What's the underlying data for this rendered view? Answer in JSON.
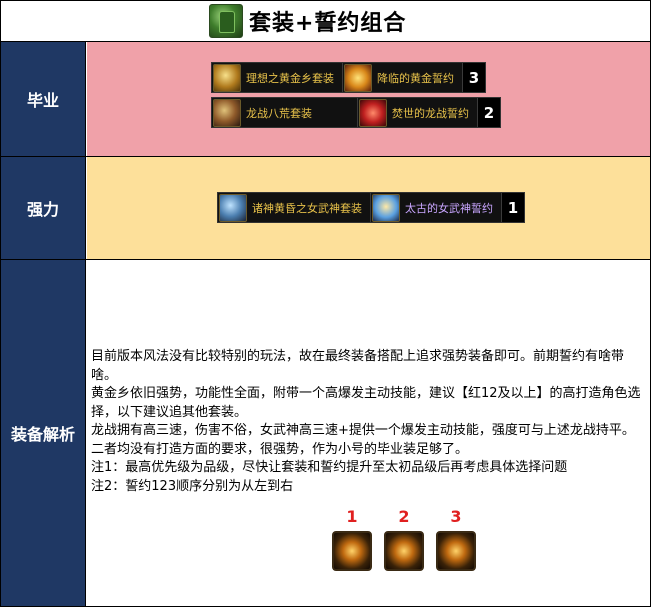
{
  "header": {
    "title": "套装+誓约组合",
    "icon": "green-armor-icon"
  },
  "rows": {
    "biye": {
      "label": "毕业",
      "combos": [
        {
          "set": "理想之黄金乡套装",
          "set_icon": "golden-land-set-icon",
          "oath": "降临的黄金誓约",
          "oath_icon": "golden-oath-icon",
          "rank": "3"
        },
        {
          "set": "龙战八荒套装",
          "set_icon": "dragon-war-set-icon",
          "oath": "焚世的龙战誓约",
          "oath_icon": "dragon-oath-icon",
          "rank": "2"
        }
      ]
    },
    "qiangli": {
      "label": "强力",
      "combos": [
        {
          "set": "诸神黄昏之女武神套装",
          "set_icon": "valkyrie-set-icon",
          "oath": "太古的女武神誓约",
          "oath_icon": "valkyrie-oath-icon",
          "rank": "1"
        }
      ]
    },
    "jiexi": {
      "label": "装备解析",
      "lines": [
        "目前版本风法没有比较特别的玩法，故在最终装备搭配上追求强势装备即可。前期誓约有啥带啥。",
        "黄金乡依旧强势，功能性全面，附带一个高爆发主动技能，建议【红12及以上】的高打造角色选择，以下建议追其他套装。",
        "龙战拥有高三速，伤害不俗，女武神高三速+提供一个爆发主动技能，强度可与上述龙战持平。二者均没有打造方面的要求，很强势，作为小号的毕业装足够了。",
        "注1：最高优先级为品级，尽快让套装和誓约提升至太初品级后再考虑具体选择问题",
        "注2：誓约123顺序分别为从左到右"
      ],
      "oath_order": [
        "1",
        "2",
        "3"
      ]
    }
  }
}
